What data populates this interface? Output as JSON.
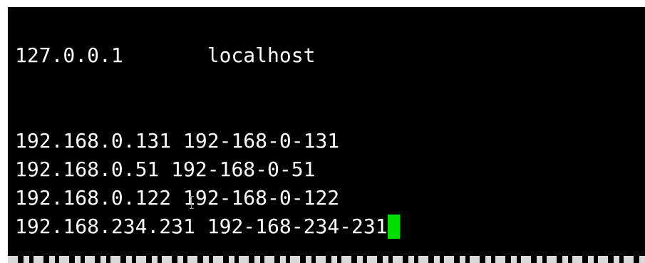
{
  "terminal": {
    "lines": [
      {
        "ip": "127.0.0.1",
        "sep": "       ",
        "host": "localhost"
      },
      {
        "ip": "192.168.0.131",
        "sep": " ",
        "host": "192-168-0-131"
      },
      {
        "ip": "192.168.0.51",
        "sep": " ",
        "host": "192-168-0-51"
      },
      {
        "ip": "192.168.0.122",
        "sep": " ",
        "host": "192-168-0-122"
      },
      {
        "ip": "192.168.234.231",
        "sep": " ",
        "host": "192-168-234-231"
      }
    ],
    "cursor_color": "#00e000",
    "background_color": "#000000",
    "text_color": "#ffffff"
  }
}
